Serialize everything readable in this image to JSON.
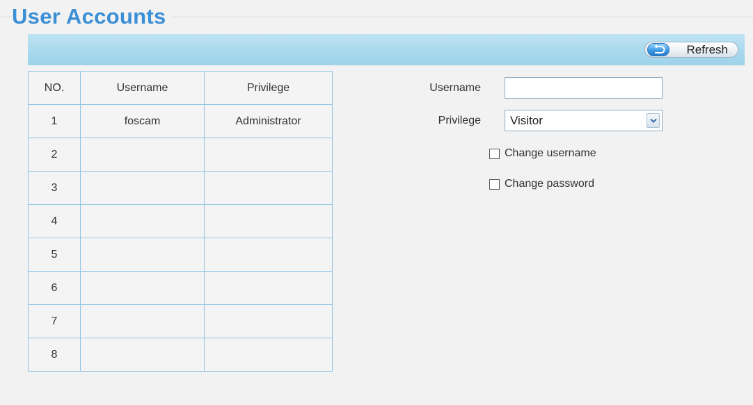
{
  "page": {
    "title": "User Accounts"
  },
  "toolbar": {
    "refresh_label": "Refresh"
  },
  "accounts_table": {
    "headers": [
      "NO.",
      "Username",
      "Privilege"
    ],
    "rows": [
      {
        "no": "1",
        "username": "foscam",
        "privilege": "Administrator"
      },
      {
        "no": "2",
        "username": "",
        "privilege": ""
      },
      {
        "no": "3",
        "username": "",
        "privilege": ""
      },
      {
        "no": "4",
        "username": "",
        "privilege": ""
      },
      {
        "no": "5",
        "username": "",
        "privilege": ""
      },
      {
        "no": "6",
        "username": "",
        "privilege": ""
      },
      {
        "no": "7",
        "username": "",
        "privilege": ""
      },
      {
        "no": "8",
        "username": "",
        "privilege": ""
      }
    ]
  },
  "form": {
    "username_label": "Username",
    "username_value": "",
    "privilege_label": "Privilege",
    "privilege_selected": "Visitor",
    "change_username_label": "Change username",
    "change_password_label": "Change password"
  },
  "colors": {
    "title": "#3b8fd6",
    "toolbar": "#a9d9ee",
    "table_border": "#8ec5e3"
  },
  "icons": {
    "refresh": "refresh-icon",
    "dropdown": "chevron-down-icon"
  }
}
